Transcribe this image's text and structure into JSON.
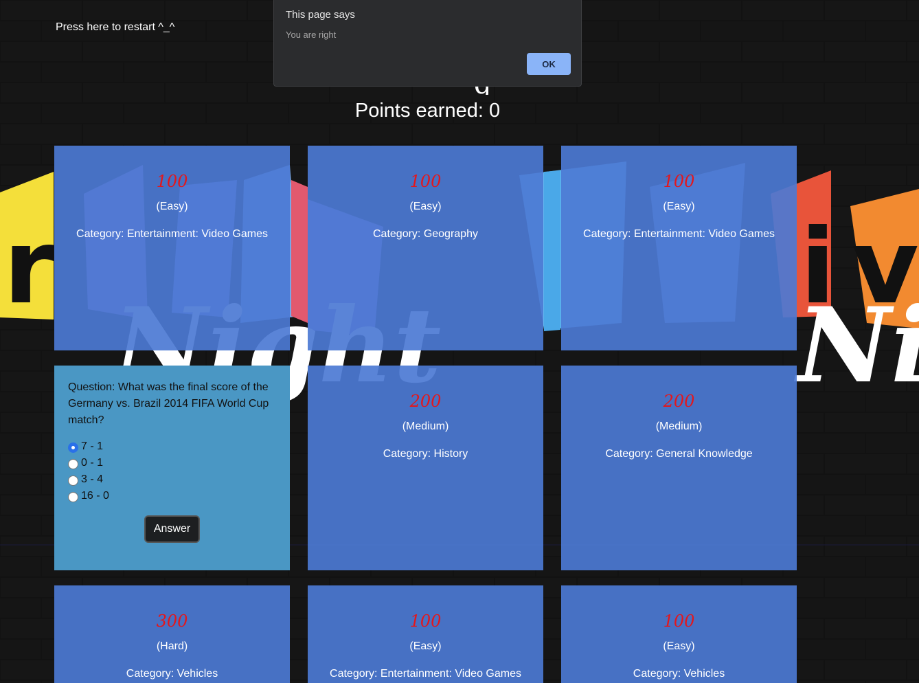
{
  "restart_label": "Press here to restart ^_^",
  "points_label": "Points earned: 0",
  "dialog": {
    "title": "This page says",
    "message": "You are right",
    "ok_label": "OK"
  },
  "cards": [
    {
      "points": "100",
      "difficulty": "(Easy)",
      "category": "Category: Entertainment: Video Games"
    },
    {
      "points": "100",
      "difficulty": "(Easy)",
      "category": "Category: Geography"
    },
    {
      "points": "100",
      "difficulty": "(Easy)",
      "category": "Category: Entertainment: Video Games"
    },
    {
      "points": "200",
      "difficulty": "(Medium)",
      "category": "Category: History"
    },
    {
      "points": "200",
      "difficulty": "(Medium)",
      "category": "Category: General Knowledge"
    },
    {
      "points": "300",
      "difficulty": "(Hard)",
      "category": "Category: Vehicles"
    },
    {
      "points": "100",
      "difficulty": "(Easy)",
      "category": "Category: Entertainment: Video Games"
    },
    {
      "points": "100",
      "difficulty": "(Easy)",
      "category": "Category: Vehicles"
    }
  ],
  "question": {
    "text": "Question: What was the final score of the Germany vs. Brazil 2014 FIFA World Cup match?",
    "options": [
      "7 - 1",
      "0 - 1",
      "3 - 4",
      "16 - 0"
    ],
    "selected_index": 0,
    "answer_label": "Answer"
  },
  "colors": {
    "card": "#4c79d4",
    "question_card": "#4a97c4",
    "points_text": "#e3171c",
    "dialog_ok": "#8ab4f8"
  }
}
